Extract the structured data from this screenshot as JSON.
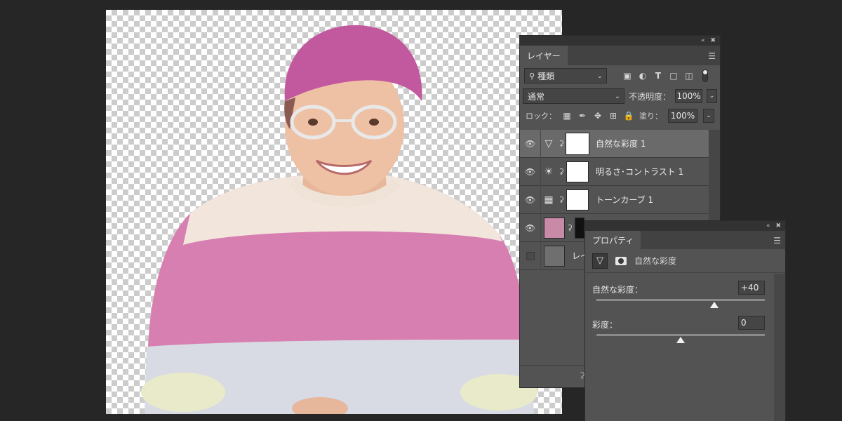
{
  "layers_panel": {
    "tab_label": "レイヤー",
    "filter": {
      "value": "種類"
    },
    "blend_mode": "通常",
    "opacity_label": "不透明度：",
    "opacity_value": "100%",
    "lock_label": "ロック：",
    "fill_label": "塗り：",
    "fill_value": "100%",
    "layers": [
      {
        "name": "自然な彩度 1",
        "selected": true
      },
      {
        "name": "明るさ･コントラスト 1",
        "selected": false
      },
      {
        "name": "トーンカーブ 1",
        "selected": false
      },
      {
        "name": "",
        "selected": false
      },
      {
        "name": "レイ",
        "selected": false
      }
    ]
  },
  "properties_panel": {
    "tab_label": "プロパティ",
    "header_title": "自然な彩度",
    "sliders": [
      {
        "label": "自然な彩度：",
        "value": "+40",
        "level": 40,
        "min": -100,
        "max": 100
      },
      {
        "label": "彩度：",
        "value": "0",
        "level": 0,
        "min": -100,
        "max": 100
      }
    ]
  },
  "colors": {
    "app_bg": "#262626",
    "panel_bg": "#535353",
    "selected_row": "#6a6a6a",
    "sweater_pink": "#d77fb1",
    "sweater_cream": "#f2e6dc",
    "sweater_grey": "#d8dbe3",
    "hair_magenta": "#c2589e"
  },
  "icons": {
    "collapse": "double-chevron-icon",
    "close": "close-icon",
    "menu": "panel-menu-icon",
    "search": "search-icon",
    "eye": "eye-icon",
    "link": "chain-link-icon"
  }
}
